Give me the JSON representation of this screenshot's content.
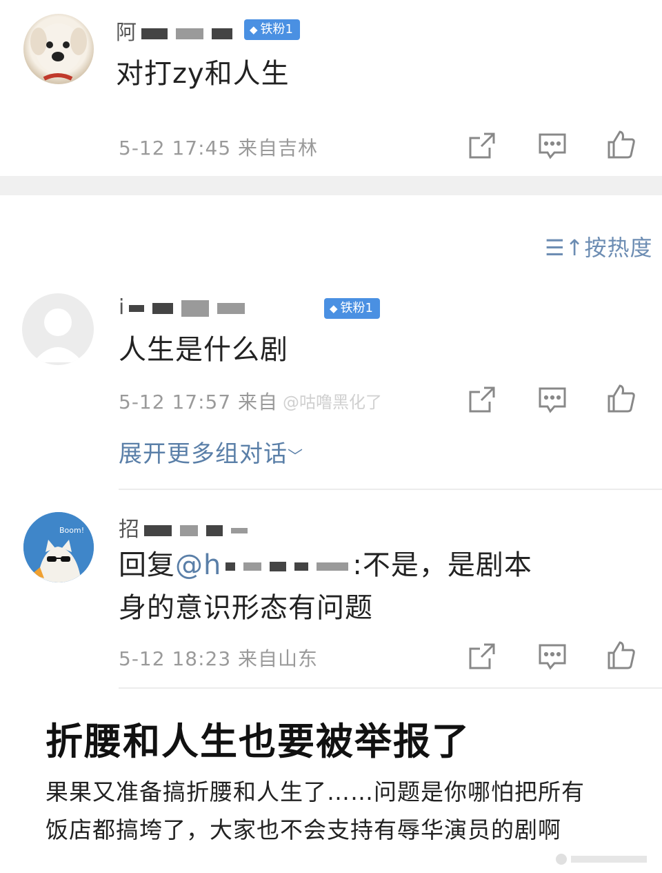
{
  "comments": [
    {
      "name_prefix": "阿",
      "badge": "铁粉1",
      "text": "对打zy和人生",
      "meta": "5-12 17:45  来自吉林"
    },
    {
      "name_prefix": "i",
      "badge": "铁粉1",
      "text": "人生是什么剧",
      "meta": "5-12 17:57  来自",
      "expand": "展开更多组对话"
    },
    {
      "name_prefix": "招",
      "reply_prefix": "回复",
      "mention": "@h",
      "text_line1": ":不是，是剧本",
      "text_line2": "身的意识形态有问题",
      "meta": "5-12 18:23  来自山东"
    }
  ],
  "sort_label": "按热度",
  "watermark": "@咕噜黑化了",
  "headline": "折腰和人生也要被举报了",
  "body_line1": "果果又准备搞折腰和人生了……问题是你哪怕把所有",
  "body_line2": "饭店都搞垮了，大家也不会支持有辱华演员的剧啊",
  "icons": [
    "share-icon",
    "comment-icon",
    "like-icon"
  ],
  "colors": {
    "badge": "#4a90e2",
    "link": "#5a7fa8",
    "meta": "#9a9a9a",
    "band": "#f0f0f0"
  }
}
